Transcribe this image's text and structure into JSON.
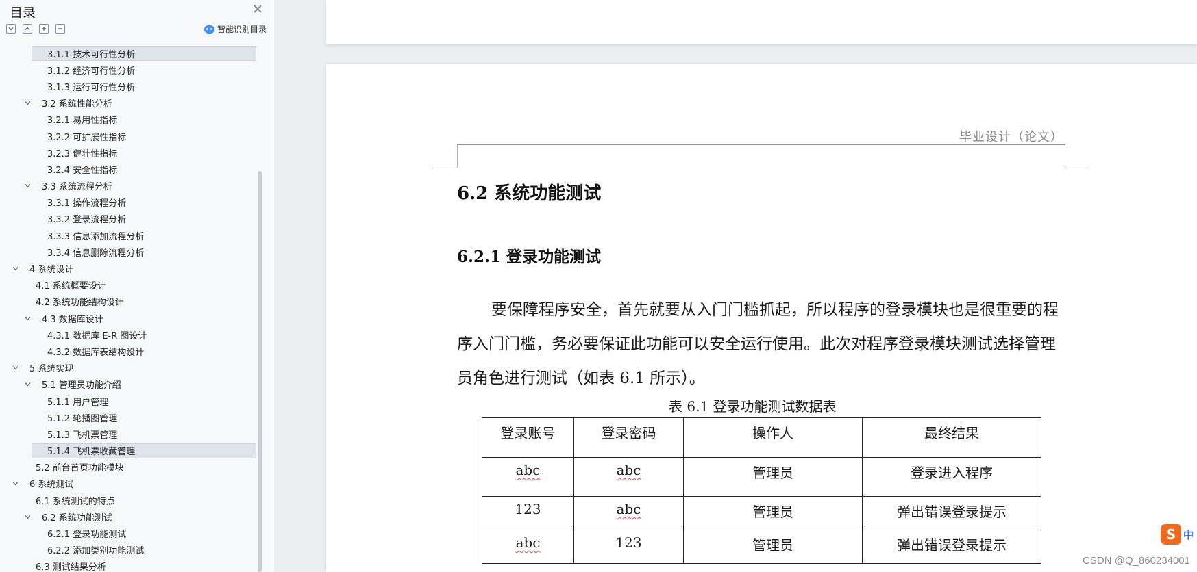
{
  "sidebar": {
    "title": "目录",
    "smart_toc_label": "智能识别目录",
    "tools": [
      "collapse-all",
      "expand-all",
      "expand-one",
      "collapse-one"
    ],
    "items": [
      {
        "label": "3.1.1  技术可行性分析",
        "level": 3,
        "selected": true
      },
      {
        "label": "3.1.2  经济可行性分析",
        "level": 3
      },
      {
        "label": "3.1.3  运行可行性分析",
        "level": 3
      },
      {
        "label": "3.2  系统性能分析",
        "level": 2,
        "expanded": true
      },
      {
        "label": "3.2.1  易用性指标",
        "level": 3
      },
      {
        "label": "3.2.2  可扩展性指标",
        "level": 3
      },
      {
        "label": "3.2.3  健壮性指标",
        "level": 3
      },
      {
        "label": "3.2.4  安全性指标",
        "level": 3
      },
      {
        "label": "3.3  系统流程分析",
        "level": 2,
        "expanded": true
      },
      {
        "label": "3.3.1  操作流程分析",
        "level": 3
      },
      {
        "label": "3.3.2  登录流程分析",
        "level": 3
      },
      {
        "label": "3.3.3  信息添加流程分析",
        "level": 3
      },
      {
        "label": "3.3.4  信息删除流程分析",
        "level": 3
      },
      {
        "label": "4  系统设计",
        "level": 1,
        "expanded": true
      },
      {
        "label": "4.1  系统概要设计",
        "level": 2
      },
      {
        "label": "4.2  系统功能结构设计",
        "level": 2
      },
      {
        "label": "4.3  数据库设计",
        "level": 2,
        "expanded": true
      },
      {
        "label": "4.3.1  数据库 E-R 图设计",
        "level": 3
      },
      {
        "label": "4.3.2  数据库表结构设计",
        "level": 3
      },
      {
        "label": "5  系统实现",
        "level": 1,
        "expanded": true
      },
      {
        "label": "5.1  管理员功能介绍",
        "level": 2,
        "expanded": true
      },
      {
        "label": "5.1.1  用户管理",
        "level": 3
      },
      {
        "label": "5.1.2  轮播图管理",
        "level": 3
      },
      {
        "label": "5.1.3  飞机票管理",
        "level": 3
      },
      {
        "label": "5.1.4  飞机票收藏管理",
        "level": 3,
        "selected": true
      },
      {
        "label": "5.2 前台首页功能模块",
        "level": 2
      },
      {
        "label": "6  系统测试",
        "level": 1,
        "expanded": true
      },
      {
        "label": "6.1  系统测试的特点",
        "level": 2
      },
      {
        "label": "6.2  系统功能测试",
        "level": 2,
        "expanded": true
      },
      {
        "label": "6.2.1  登录功能测试",
        "level": 3
      },
      {
        "label": "6.2.2  添加类别功能测试",
        "level": 3
      },
      {
        "label": "6.3  测试结果分析",
        "level": 2
      }
    ]
  },
  "document": {
    "header_text": "毕业设计（论文）",
    "section_heading": "6.2  系统功能测试",
    "subsection_heading": "6.2.1  登录功能测试",
    "paragraph": "要保障程序安全，首先就要从入门门槛抓起，所以程序的登录模块也是很重要的程序入门门槛，务必要保证此功能可以安全运行使用。此次对程序登录模块测试选择管理员角色进行测试（如表 6.1 所示）。",
    "table_caption": "表 6.1  登录功能测试数据表",
    "table": {
      "headers": [
        "登录账号",
        "登录密码",
        "操作人",
        "最终结果"
      ],
      "rows": [
        [
          "abc",
          "abc",
          "管理员",
          "登录进入程序"
        ],
        [
          "123",
          "abc",
          "管理员",
          "弹出错误登录提示"
        ],
        [
          "abc",
          "123",
          "管理员",
          "弹出错误登录提示"
        ]
      ]
    }
  },
  "watermark": "CSDN @Q_860234001",
  "ime": {
    "logo": "S",
    "label": "中"
  },
  "colors": {
    "sidebar_bg": "#f7f8fa",
    "selected_bg": "#dfe3ea",
    "doc_bg": "#eceef1",
    "spell_underline": "#e0474c",
    "ime_orange": "#ef6a21"
  }
}
